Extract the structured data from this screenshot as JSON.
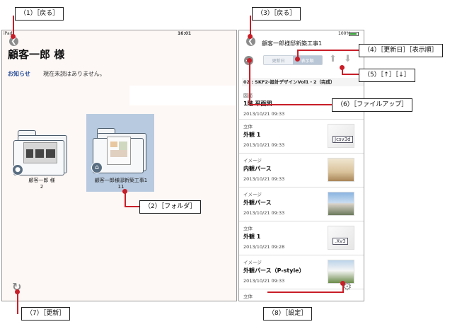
{
  "left": {
    "status": {
      "carrier": "iPad",
      "time": "16:01"
    },
    "back_glyph": "❮",
    "customer_title": "顧客一郎 様",
    "notice_label": "お知らせ",
    "notice_text": "現在未読はありません。",
    "folders": [
      {
        "name": "顧客一郎 様",
        "count": "2",
        "icon": "user-icon"
      },
      {
        "name": "顧客一郎様邸新築工事1",
        "count": "11",
        "icon": "house-icon"
      }
    ],
    "refresh_glyph": "↻"
  },
  "right": {
    "status": {
      "battery_pct": "100%"
    },
    "back_glyph": "❮",
    "title": "顧客一郎様邸新築工事1",
    "sort": {
      "date_label": "更新日",
      "order_label": "表示順"
    },
    "add_glyph": "+",
    "arrow_up": "⬆",
    "arrow_down": "⬇",
    "folder_path": "02 : SKF2-設計デザインVol1・2（完成）",
    "files": [
      {
        "category": "図面",
        "name": "1階 平面図",
        "date": "2013/10/21 09:33",
        "thumb": "none"
      },
      {
        "category": "立体",
        "name": "外観 1",
        "date": "2013/10/21 09:33",
        "thumb": "doc",
        "thumb_label": "Jcsv3d"
      },
      {
        "category": "イメージ",
        "name": "内観パース",
        "date": "2013/10/21 09:33",
        "thumb": "interior"
      },
      {
        "category": "イメージ",
        "name": "外観パース",
        "date": "2013/10/21 09:33",
        "thumb": "house"
      },
      {
        "category": "立体",
        "name": "外観 1",
        "date": "2013/10/21 09:28",
        "thumb": "doc",
        "thumb_label": ".Xv3"
      },
      {
        "category": "イメージ",
        "name": "外観パース（P-style）",
        "date": "2013/10/21 09:33",
        "thumb": "house2"
      },
      {
        "category": "立体",
        "name": "",
        "date": "",
        "thumb": "doc",
        "thumb_label": ""
      }
    ],
    "settings_glyph": "⚙"
  },
  "callouts": {
    "c1": "（1）［戻る］",
    "c2": "（2）［フォルダ］",
    "c3": "（3）［戻る］",
    "c4": "（4）［更新日］［表示順］",
    "c5": "（5）［↑］［↓］",
    "c6": "（6）［ファイルアップ］",
    "c7": "（7）［更新］",
    "c8": "（8）［設定］"
  },
  "colors": {
    "callout_red": "#c81e28",
    "highlight": "#b8cadf",
    "link_blue": "#2a4f9a"
  }
}
